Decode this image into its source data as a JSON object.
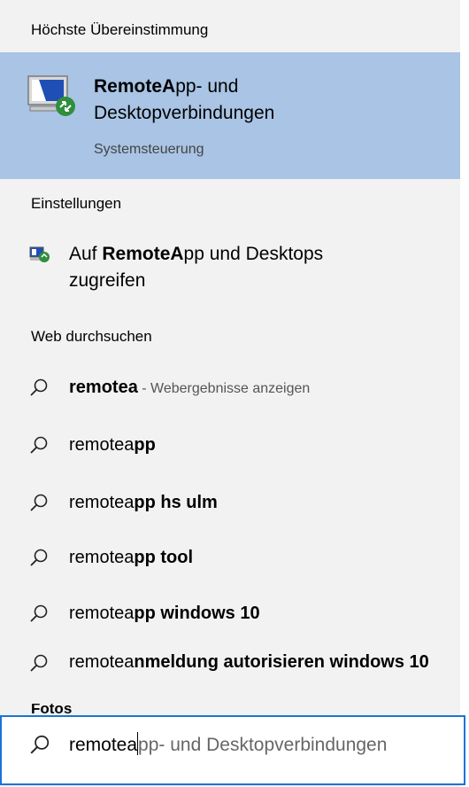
{
  "sections": {
    "best_match": "Höchste Übereinstimmung",
    "settings": "Einstellungen",
    "web": "Web durchsuchen",
    "photos_partial": "Fotos"
  },
  "best_match_item": {
    "title_bold": "RemoteA",
    "title_rest": "pp- und",
    "title_line2": "Desktopverbindungen",
    "subtitle": "Systemsteuerung",
    "icon": "remote-desktop-icon"
  },
  "settings_item": {
    "prefix": "Auf ",
    "bold": "RemoteA",
    "rest": "pp und Desktops",
    "line2": "zugreifen",
    "icon": "remoteapp-settings-icon"
  },
  "web_results": [
    {
      "normal": "remotea",
      "bold": "",
      "hint": " - Webergebnisse anzeigen",
      "first_bold": true
    },
    {
      "normal": "remotea",
      "bold": "pp"
    },
    {
      "normal": "remotea",
      "bold": "pp hs ulm"
    },
    {
      "normal": "remotea",
      "bold": "pp tool"
    },
    {
      "normal": "remotea",
      "bold": "pp windows 10"
    },
    {
      "normal": "remotea",
      "bold": "nmeldung autorisieren windows 10"
    }
  ],
  "search": {
    "typed": "remotea",
    "autocomplete": "pp- und Desktopverbindungen",
    "icon": "search-icon"
  },
  "colors": {
    "background": "#f2f2f2",
    "selected": "#a9c4e4",
    "search_border": "#1a73d9"
  }
}
